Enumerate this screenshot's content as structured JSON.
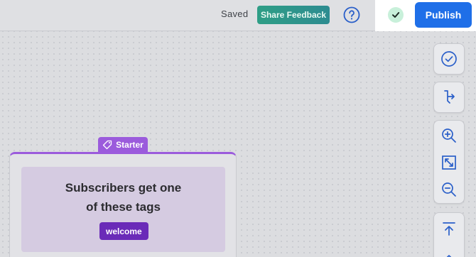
{
  "header": {
    "status": "Saved",
    "share_feedback_label": "Share Feedback",
    "publish_label": "Publish"
  },
  "toolbar": {
    "icons": [
      "check-circle-icon",
      "flow-branch-icon",
      "zoom-in-icon",
      "fit-screen-icon",
      "zoom-out-icon",
      "arrow-to-top-icon",
      "chevron-up-icon"
    ]
  },
  "canvas": {
    "starter_node": {
      "badge": "Starter",
      "title_line1": "Subscribers get one",
      "title_line2": "of these tags",
      "tags": [
        "welcome"
      ]
    }
  },
  "colors": {
    "accent_blue": "#1f6fe8",
    "starter_purple": "#9b5bdc",
    "tag_purple": "#6a2bb8",
    "share_green": "#2f9e86",
    "success_green": "#c8f0da"
  }
}
